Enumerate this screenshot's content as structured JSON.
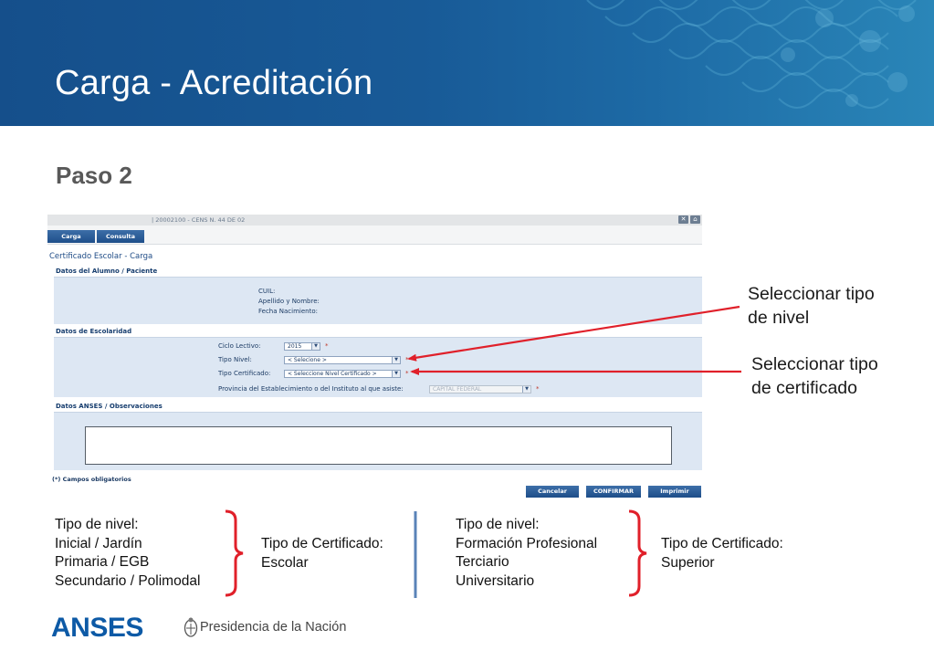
{
  "slide": {
    "title": "Carga - Acreditación",
    "subtitle": "Paso 2"
  },
  "app": {
    "institution": "| 20002100 - CENS N. 44 DE 02",
    "nav": {
      "carga": "Carga",
      "consulta": "Consulta"
    },
    "form_title": "Certificado Escolar - Carga",
    "sections": {
      "alumno": "Datos del Alumno / Paciente",
      "escolaridad": "Datos de Escolaridad",
      "anses": "Datos ANSES / Observaciones"
    },
    "alumno_fields": {
      "cuil": "CUIL:",
      "apellido": "Apellido y Nombre:",
      "nacimiento": "Fecha Nacimiento:"
    },
    "escolaridad_fields": {
      "ciclo_label": "Ciclo Lectivo:",
      "ciclo_value": "2015",
      "tipo_nivel_label": "Tipo Nivel:",
      "tipo_nivel_value": "< Selecione >",
      "tipo_cert_label": "Tipo Certificado:",
      "tipo_cert_value": "< Seleccione Nivel Certificado >",
      "provincia_label": "Provincia del Establecimiento o del Instituto al que asiste:",
      "provincia_value": "CAPITAL FEDERAL",
      "required_mark": "*"
    },
    "oblig_note": "(*) Campos obligatorios",
    "buttons": {
      "cancelar": "Cancelar",
      "confirmar": "CONFIRMAR",
      "imprimir": "Imprimir"
    }
  },
  "callouts": {
    "nivel": [
      "Seleccionar tipo",
      "de nivel"
    ],
    "certificado": [
      "Seleccionar tipo",
      "de certificado"
    ]
  },
  "lists": {
    "group1_levels": [
      "Tipo de nivel:",
      "Inicial  / Jardín",
      "Primaria / EGB",
      "Secundario / Polimodal"
    ],
    "group1_cert": [
      "Tipo de Certificado:",
      "Escolar"
    ],
    "group2_levels": [
      "Tipo de nivel:",
      "Formación Profesional",
      "Terciario",
      "Universitario"
    ],
    "group2_cert": [
      "Tipo de Certificado:",
      "Superior"
    ]
  },
  "footer": {
    "anses": "ANSES",
    "presidencia": "Presidencia de la Nación"
  },
  "colors": {
    "banner": "#185a97",
    "accent_red": "#e0202a",
    "divider_blue": "#5a83b8"
  }
}
